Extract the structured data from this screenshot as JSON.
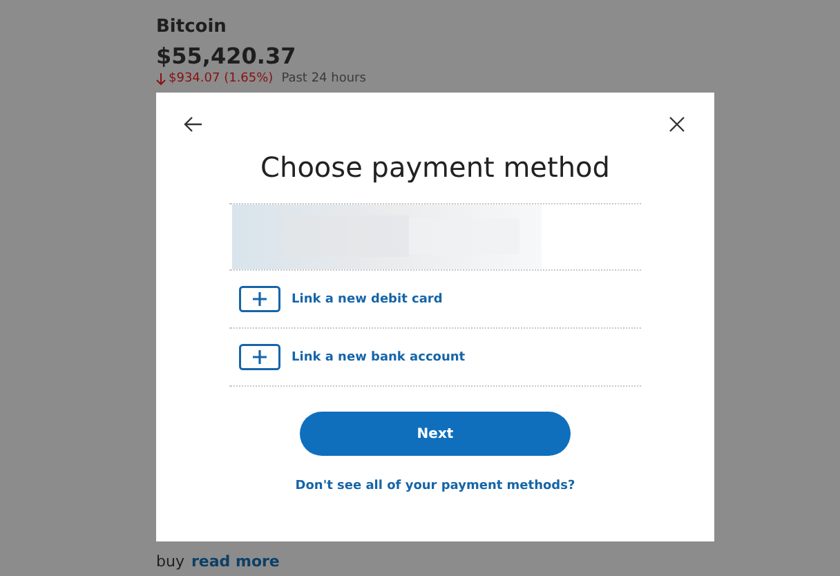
{
  "background": {
    "asset": "Bitcoin",
    "price": "$55,420.37",
    "change": "$934.07 (1.65%)",
    "period": "Past 24 hours",
    "body_end": "buy",
    "read_more": "read more"
  },
  "dialog": {
    "title": "Choose payment method",
    "options": [
      {
        "label": "Link a new debit card"
      },
      {
        "label": "Link a new bank account"
      }
    ],
    "next_button": "Next",
    "help_link": "Don't see all of your payment methods?"
  }
}
